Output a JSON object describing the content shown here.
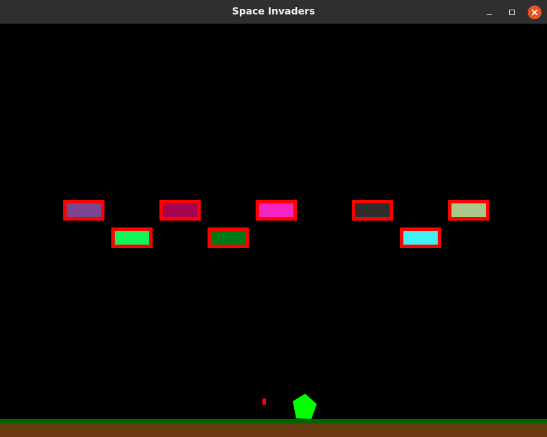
{
  "window": {
    "title": "Space Invaders"
  },
  "titlebar_buttons": {
    "minimize_icon": "minimize-icon",
    "maximize_icon": "maximize-icon",
    "close_icon": "close-icon",
    "close_color": "#e95420"
  },
  "invaders": [
    {
      "fill": "#7b4592",
      "border": "#ff0000"
    },
    {
      "fill": "#a3034f",
      "border": "#ff0000"
    },
    {
      "fill": "#f524c3",
      "border": "#ff0000"
    },
    {
      "fill": "#2d2d2d",
      "border": "#ff0000"
    },
    {
      "fill": "#a9c88a",
      "border": "#ff0000"
    },
    {
      "fill": "#12f45b",
      "border": "#ff0000"
    },
    {
      "fill": "#007a12",
      "border": "#ff0000"
    },
    {
      "fill": "#41f0f2",
      "border": "#ff0000"
    }
  ],
  "player": {
    "shape": "pentagon",
    "color": "#00ff00"
  },
  "bullet": {
    "color": "#ff0000"
  },
  "ground": {
    "grass_color": "#006400",
    "dirt_color": "#6b3a10"
  }
}
